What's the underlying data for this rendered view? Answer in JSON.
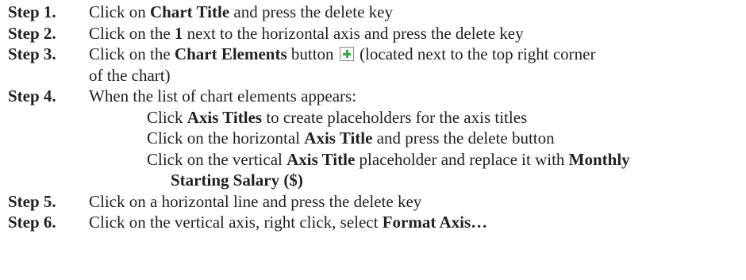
{
  "steps": [
    {
      "label": "Step 1.",
      "parts": [
        "Click on ",
        "Chart Title",
        " and press the delete key"
      ]
    },
    {
      "label": "Step 2.",
      "parts": [
        "Click on the ",
        "1",
        " next to the horizontal axis and press the delete key"
      ]
    },
    {
      "label": "Step 3.",
      "parts": [
        "Click on the ",
        "Chart Elements",
        " button",
        " (located next to the top right corner",
        "of the chart)"
      ],
      "button_icon": "plus-icon"
    },
    {
      "label": "Step 4.",
      "intro": "When the list of chart elements appears:",
      "subitems": [
        [
          "Click ",
          "Axis Titles",
          " to create placeholders for the axis titles"
        ],
        [
          "Click on the horizontal ",
          "Axis Title",
          " and press the delete button"
        ],
        [
          "Click on the vertical ",
          "Axis Title",
          " placeholder and replace it with ",
          "Monthly",
          "Starting Salary ($)"
        ]
      ]
    },
    {
      "label": "Step 5.",
      "parts": [
        "Click on a horizontal line and press the delete key"
      ]
    },
    {
      "label": "Step 6.",
      "parts": [
        "Click on the vertical axis, right click, select ",
        "Format Axis…"
      ]
    }
  ],
  "colors": {
    "text": "#231f20",
    "plus_icon": "#3aa84a"
  }
}
